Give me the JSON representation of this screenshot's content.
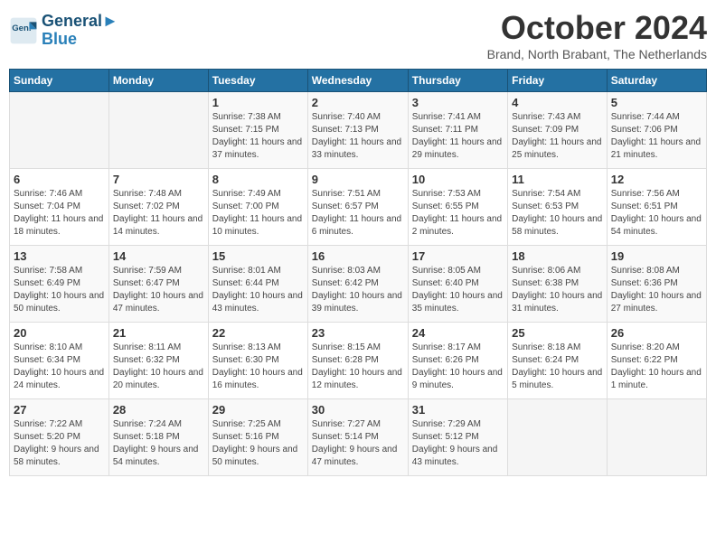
{
  "header": {
    "logo_line1": "General",
    "logo_line2": "Blue",
    "month_title": "October 2024",
    "location": "Brand, North Brabant, The Netherlands"
  },
  "weekdays": [
    "Sunday",
    "Monday",
    "Tuesday",
    "Wednesday",
    "Thursday",
    "Friday",
    "Saturday"
  ],
  "weeks": [
    [
      {
        "day": "",
        "empty": true
      },
      {
        "day": "",
        "empty": true
      },
      {
        "day": "1",
        "sunrise": "7:38 AM",
        "sunset": "7:15 PM",
        "daylight": "11 hours and 37 minutes."
      },
      {
        "day": "2",
        "sunrise": "7:40 AM",
        "sunset": "7:13 PM",
        "daylight": "11 hours and 33 minutes."
      },
      {
        "day": "3",
        "sunrise": "7:41 AM",
        "sunset": "7:11 PM",
        "daylight": "11 hours and 29 minutes."
      },
      {
        "day": "4",
        "sunrise": "7:43 AM",
        "sunset": "7:09 PM",
        "daylight": "11 hours and 25 minutes."
      },
      {
        "day": "5",
        "sunrise": "7:44 AM",
        "sunset": "7:06 PM",
        "daylight": "11 hours and 21 minutes."
      }
    ],
    [
      {
        "day": "6",
        "sunrise": "7:46 AM",
        "sunset": "7:04 PM",
        "daylight": "11 hours and 18 minutes."
      },
      {
        "day": "7",
        "sunrise": "7:48 AM",
        "sunset": "7:02 PM",
        "daylight": "11 hours and 14 minutes."
      },
      {
        "day": "8",
        "sunrise": "7:49 AM",
        "sunset": "7:00 PM",
        "daylight": "11 hours and 10 minutes."
      },
      {
        "day": "9",
        "sunrise": "7:51 AM",
        "sunset": "6:57 PM",
        "daylight": "11 hours and 6 minutes."
      },
      {
        "day": "10",
        "sunrise": "7:53 AM",
        "sunset": "6:55 PM",
        "daylight": "11 hours and 2 minutes."
      },
      {
        "day": "11",
        "sunrise": "7:54 AM",
        "sunset": "6:53 PM",
        "daylight": "10 hours and 58 minutes."
      },
      {
        "day": "12",
        "sunrise": "7:56 AM",
        "sunset": "6:51 PM",
        "daylight": "10 hours and 54 minutes."
      }
    ],
    [
      {
        "day": "13",
        "sunrise": "7:58 AM",
        "sunset": "6:49 PM",
        "daylight": "10 hours and 50 minutes."
      },
      {
        "day": "14",
        "sunrise": "7:59 AM",
        "sunset": "6:47 PM",
        "daylight": "10 hours and 47 minutes."
      },
      {
        "day": "15",
        "sunrise": "8:01 AM",
        "sunset": "6:44 PM",
        "daylight": "10 hours and 43 minutes."
      },
      {
        "day": "16",
        "sunrise": "8:03 AM",
        "sunset": "6:42 PM",
        "daylight": "10 hours and 39 minutes."
      },
      {
        "day": "17",
        "sunrise": "8:05 AM",
        "sunset": "6:40 PM",
        "daylight": "10 hours and 35 minutes."
      },
      {
        "day": "18",
        "sunrise": "8:06 AM",
        "sunset": "6:38 PM",
        "daylight": "10 hours and 31 minutes."
      },
      {
        "day": "19",
        "sunrise": "8:08 AM",
        "sunset": "6:36 PM",
        "daylight": "10 hours and 27 minutes."
      }
    ],
    [
      {
        "day": "20",
        "sunrise": "8:10 AM",
        "sunset": "6:34 PM",
        "daylight": "10 hours and 24 minutes."
      },
      {
        "day": "21",
        "sunrise": "8:11 AM",
        "sunset": "6:32 PM",
        "daylight": "10 hours and 20 minutes."
      },
      {
        "day": "22",
        "sunrise": "8:13 AM",
        "sunset": "6:30 PM",
        "daylight": "10 hours and 16 minutes."
      },
      {
        "day": "23",
        "sunrise": "8:15 AM",
        "sunset": "6:28 PM",
        "daylight": "10 hours and 12 minutes."
      },
      {
        "day": "24",
        "sunrise": "8:17 AM",
        "sunset": "6:26 PM",
        "daylight": "10 hours and 9 minutes."
      },
      {
        "day": "25",
        "sunrise": "8:18 AM",
        "sunset": "6:24 PM",
        "daylight": "10 hours and 5 minutes."
      },
      {
        "day": "26",
        "sunrise": "8:20 AM",
        "sunset": "6:22 PM",
        "daylight": "10 hours and 1 minute."
      }
    ],
    [
      {
        "day": "27",
        "sunrise": "7:22 AM",
        "sunset": "5:20 PM",
        "daylight": "9 hours and 58 minutes."
      },
      {
        "day": "28",
        "sunrise": "7:24 AM",
        "sunset": "5:18 PM",
        "daylight": "9 hours and 54 minutes."
      },
      {
        "day": "29",
        "sunrise": "7:25 AM",
        "sunset": "5:16 PM",
        "daylight": "9 hours and 50 minutes."
      },
      {
        "day": "30",
        "sunrise": "7:27 AM",
        "sunset": "5:14 PM",
        "daylight": "9 hours and 47 minutes."
      },
      {
        "day": "31",
        "sunrise": "7:29 AM",
        "sunset": "5:12 PM",
        "daylight": "9 hours and 43 minutes."
      },
      {
        "day": "",
        "empty": true
      },
      {
        "day": "",
        "empty": true
      }
    ]
  ]
}
